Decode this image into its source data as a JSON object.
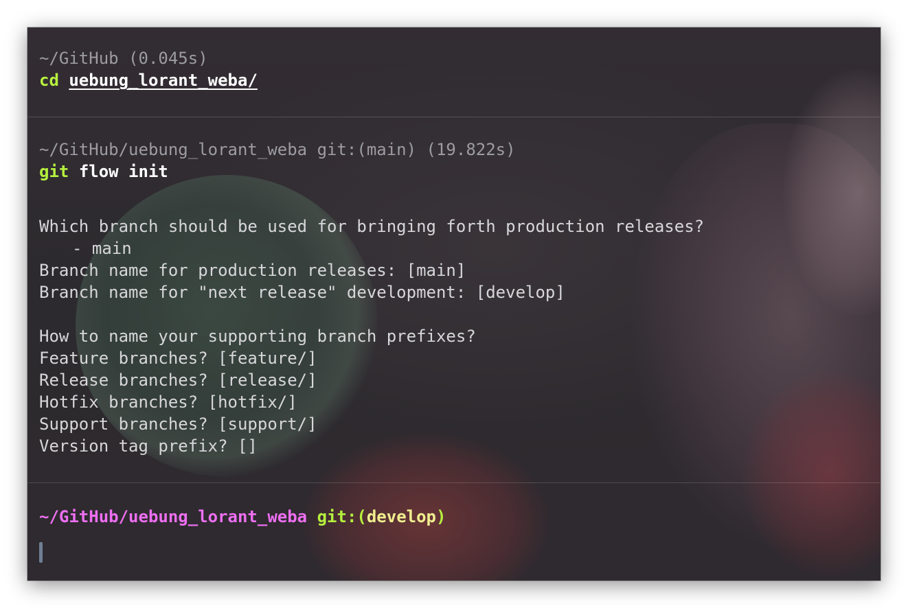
{
  "blocks": [
    {
      "meta": "~/GitHub (0.045s)",
      "command_verb": "cd",
      "command_args": "uebung_lorant_weba/"
    },
    {
      "meta": "~/GitHub/uebung_lorant_weba git:(main) (19.822s)",
      "command_verb": "git",
      "command_args": "flow init",
      "output": {
        "question": "Which branch should be used for bringing forth production releases?",
        "existing_branch": "- main",
        "production_branch": "Branch name for production releases: [main]",
        "next_release_branch": "Branch name for \"next release\" development: [develop]",
        "prefix_question": "How to name your supporting branch prefixes?",
        "feature": "Feature branches? [feature/]",
        "release": "Release branches? [release/]",
        "hotfix": "Hotfix branches? [hotfix/]",
        "support": "Support branches? [support/]",
        "version_tag": "Version tag prefix? []"
      }
    }
  ],
  "prompt": {
    "path": "~/GitHub/uebung_lorant_weba",
    "git_label": "git:",
    "open_paren": "(",
    "branch": "develop",
    "close_paren": ")"
  },
  "colors": {
    "command_green": "#b6f03e",
    "prompt_path_magenta": "#ee6ff2",
    "branch_yellow": "#f0ee8e",
    "meta_gray": "#9c9ca2",
    "text": "#d7d7d9"
  }
}
